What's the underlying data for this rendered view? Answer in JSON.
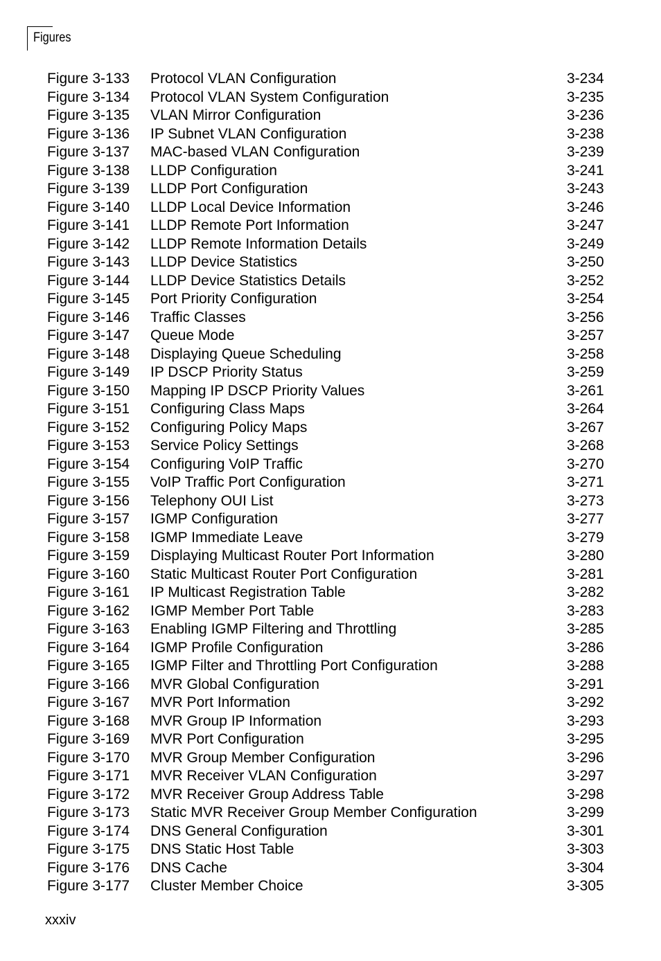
{
  "header": {
    "section_title": "Figures"
  },
  "entries": [
    {
      "figure": "Figure 3-133",
      "title": "Protocol VLAN Configuration",
      "page": "3-234"
    },
    {
      "figure": "Figure 3-134",
      "title": "Protocol VLAN System Configuration",
      "page": "3-235"
    },
    {
      "figure": "Figure 3-135",
      "title": "VLAN Mirror Configuration",
      "page": "3-236"
    },
    {
      "figure": "Figure 3-136",
      "title": "IP Subnet VLAN Configuration",
      "page": "3-238"
    },
    {
      "figure": "Figure 3-137",
      "title": "MAC-based VLAN Configuration",
      "page": "3-239"
    },
    {
      "figure": "Figure 3-138",
      "title": "LLDP Configuration",
      "page": "3-241"
    },
    {
      "figure": "Figure 3-139",
      "title": "LLDP Port Configuration",
      "page": "3-243"
    },
    {
      "figure": "Figure 3-140",
      "title": "LLDP Local Device Information",
      "page": "3-246"
    },
    {
      "figure": "Figure 3-141",
      "title": "LLDP Remote Port Information",
      "page": "3-247"
    },
    {
      "figure": "Figure 3-142",
      "title": "LLDP Remote Information Details",
      "page": "3-249"
    },
    {
      "figure": "Figure 3-143",
      "title": "LLDP Device Statistics",
      "page": "3-250"
    },
    {
      "figure": "Figure 3-144",
      "title": "LLDP Device Statistics Details",
      "page": "3-252"
    },
    {
      "figure": "Figure 3-145",
      "title": "Port Priority Configuration",
      "page": "3-254"
    },
    {
      "figure": "Figure 3-146",
      "title": "Traffic Classes",
      "page": "3-256"
    },
    {
      "figure": "Figure 3-147",
      "title": "Queue Mode",
      "page": "3-257"
    },
    {
      "figure": "Figure 3-148",
      "title": "Displaying Queue Scheduling",
      "page": "3-258"
    },
    {
      "figure": "Figure 3-149",
      "title": "IP DSCP Priority Status",
      "page": "3-259"
    },
    {
      "figure": "Figure 3-150",
      "title": "Mapping IP DSCP Priority Values",
      "page": "3-261"
    },
    {
      "figure": "Figure 3-151",
      "title": "Configuring Class Maps",
      "page": "3-264"
    },
    {
      "figure": "Figure 3-152",
      "title": "Configuring Policy Maps",
      "page": "3-267"
    },
    {
      "figure": "Figure 3-153",
      "title": "Service Policy Settings",
      "page": "3-268"
    },
    {
      "figure": "Figure 3-154",
      "title": "Configuring VoIP Traffic",
      "page": "3-270"
    },
    {
      "figure": "Figure 3-155",
      "title": "VoIP Traffic Port Configuration",
      "page": "3-271"
    },
    {
      "figure": "Figure 3-156",
      "title": "Telephony OUI List",
      "page": "3-273"
    },
    {
      "figure": "Figure 3-157",
      "title": "IGMP Configuration",
      "page": "3-277"
    },
    {
      "figure": "Figure 3-158",
      "title": "IGMP Immediate Leave",
      "page": "3-279"
    },
    {
      "figure": "Figure 3-159",
      "title": "Displaying Multicast Router Port Information",
      "page": "3-280"
    },
    {
      "figure": "Figure 3-160",
      "title": "Static Multicast Router Port Configuration",
      "page": "3-281"
    },
    {
      "figure": "Figure 3-161",
      "title": "IP Multicast Registration Table",
      "page": "3-282"
    },
    {
      "figure": "Figure 3-162",
      "title": "IGMP Member Port Table",
      "page": "3-283"
    },
    {
      "figure": "Figure 3-163",
      "title": "Enabling IGMP Filtering and Throttling",
      "page": "3-285"
    },
    {
      "figure": "Figure 3-164",
      "title": "IGMP Profile Configuration",
      "page": "3-286"
    },
    {
      "figure": "Figure 3-165",
      "title": "IGMP Filter and Throttling Port Configuration",
      "page": "3-288"
    },
    {
      "figure": "Figure 3-166",
      "title": "MVR Global Configuration",
      "page": "3-291"
    },
    {
      "figure": "Figure 3-167",
      "title": "MVR Port Information",
      "page": "3-292"
    },
    {
      "figure": "Figure 3-168",
      "title": "MVR Group IP Information",
      "page": "3-293"
    },
    {
      "figure": "Figure 3-169",
      "title": "MVR Port Configuration",
      "page": "3-295"
    },
    {
      "figure": "Figure 3-170",
      "title": "MVR Group Member Configuration",
      "page": "3-296"
    },
    {
      "figure": "Figure 3-171",
      "title": "MVR Receiver VLAN Configuration",
      "page": "3-297"
    },
    {
      "figure": "Figure 3-172",
      "title": "MVR Receiver Group Address Table",
      "page": "3-298"
    },
    {
      "figure": "Figure 3-173",
      "title": "Static MVR Receiver Group Member Configuration",
      "page": "3-299"
    },
    {
      "figure": "Figure 3-174",
      "title": "DNS General Configuration",
      "page": "3-301"
    },
    {
      "figure": "Figure 3-175",
      "title": "DNS Static Host Table",
      "page": "3-303"
    },
    {
      "figure": "Figure 3-176",
      "title": "DNS Cache",
      "page": "3-304"
    },
    {
      "figure": "Figure 3-177",
      "title": "Cluster Member Choice",
      "page": "3-305"
    }
  ],
  "footer": {
    "page_number": "xxxiv"
  }
}
